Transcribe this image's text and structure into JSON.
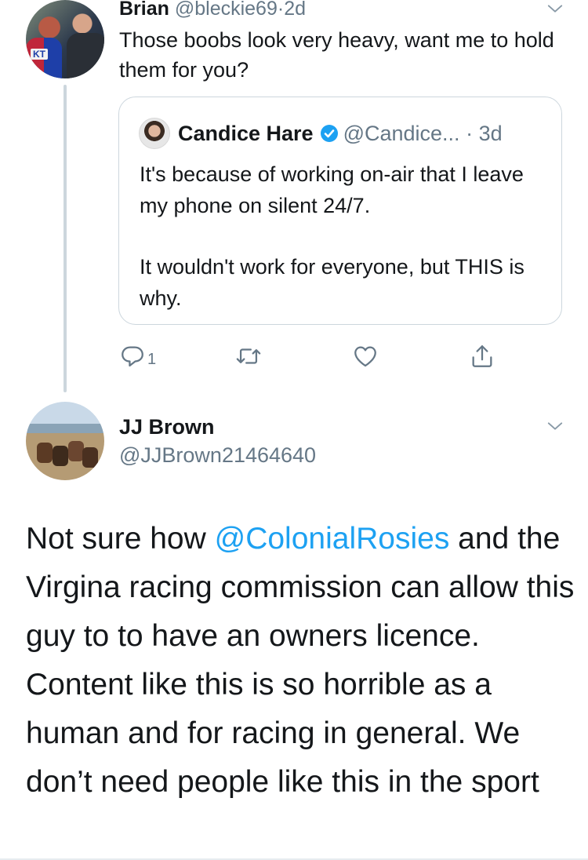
{
  "reply_tweet": {
    "name": "Brian",
    "handle": "@bleckie69",
    "separator": "·",
    "time": "2d",
    "text": "Those boobs look very heavy, want me to hold them for you?",
    "avatar_icon": "user-avatar-photo"
  },
  "quoted_tweet": {
    "name": "Candice Hare",
    "handle": "@Candice...",
    "separator": "·",
    "time": "3d",
    "verified_icon": "verified-badge-icon",
    "text_paragraph_1": "It's because of working on-air that I leave my phone on silent 24/7.",
    "text_paragraph_2": "It wouldn't work for everyone, but THIS is why."
  },
  "actions": {
    "reply_count": "1",
    "icons": [
      "reply-icon",
      "retweet-icon",
      "like-icon",
      "share-icon"
    ]
  },
  "main_tweet": {
    "name": "JJ Brown",
    "handle": "@JJBrown21464640",
    "text_before_mention": "Not sure how ",
    "mention": "@ColonialRosies",
    "text_after_mention": " and the Virgina racing commission can allow this guy to to have an owners licence. Content like this is so horrible as a human and for racing in general. We don’t need people like this in the sport"
  },
  "colors": {
    "text": "#14171a",
    "secondary": "#657786",
    "link": "#1da1f2",
    "border": "#ccd6dd",
    "icon": "#657786"
  }
}
